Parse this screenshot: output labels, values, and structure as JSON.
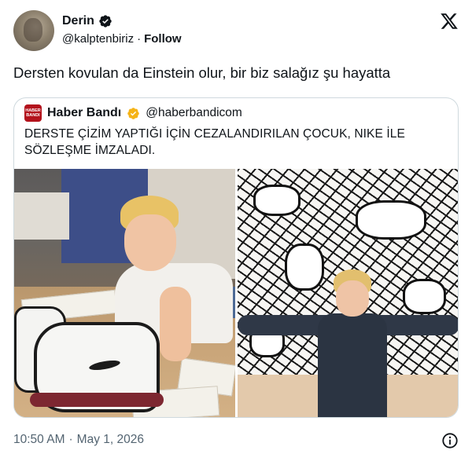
{
  "tweet": {
    "author": {
      "display_name": "Derin",
      "handle": "@kalptenbiriz",
      "follow_label": "Follow",
      "verified": true
    },
    "text": "Dersten kovulan da Einstein olur, bir biz salağız şu hayatta",
    "separator": "·",
    "footer": {
      "time": "10:50 AM",
      "date": "May 1, 2026"
    }
  },
  "quote": {
    "avatar_text_line1": "HABER",
    "avatar_text_line2": "BANDI",
    "display_name": "Haber Bandı",
    "handle": "@haberbandicom",
    "verified_color": "#f5b316",
    "text": "DERSTE ÇİZİM YAPTIĞI İÇİN CEZALANDIRILAN ÇOCUK, NIKE İLE SÖZLEŞME İMZALADI."
  },
  "colors": {
    "verified_blue": "#1d9bf0",
    "text": "#0f1419",
    "muted": "#536471",
    "border": "#cfd9de",
    "brand_red": "#b3121c"
  },
  "icons": {
    "verified": "verified-badge-icon",
    "x_logo": "x-logo-icon",
    "info": "info-icon"
  }
}
